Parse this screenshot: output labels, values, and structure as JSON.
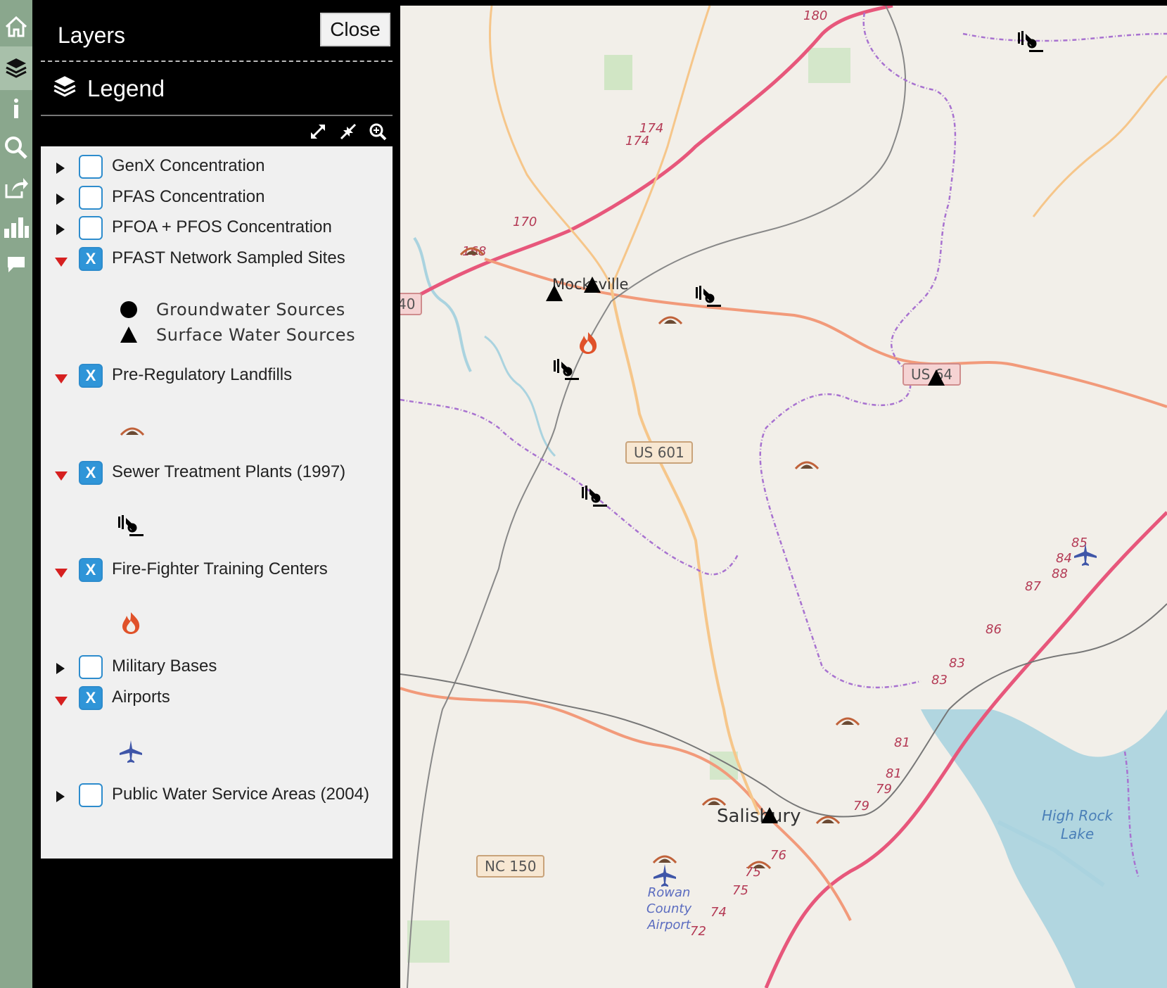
{
  "toolbar": {
    "icons": [
      "home-icon",
      "layers-icon",
      "info-icon",
      "search-icon",
      "share-icon",
      "chart-icon",
      "comment-icon"
    ]
  },
  "panel": {
    "title": "Layers",
    "close_label": "Close",
    "legend_title": "Legend",
    "controls": [
      "expand-icon",
      "collapse-icon",
      "zoom-icon"
    ]
  },
  "layers": [
    {
      "label": "GenX Concentration",
      "checked": false,
      "expanded": false
    },
    {
      "label": "PFAS Concentration",
      "checked": false,
      "expanded": false
    },
    {
      "label": "PFOA + PFOS Concentration",
      "checked": false,
      "expanded": false
    },
    {
      "label": "PFAST Network Sampled Sites",
      "checked": true,
      "expanded": true,
      "symbols": [
        {
          "shape": "circle",
          "label": "Groundwater Sources"
        },
        {
          "shape": "triangle",
          "label": "Surface Water Sources"
        }
      ]
    },
    {
      "label": "Pre-Regulatory Landfills",
      "checked": true,
      "expanded": true,
      "symbol": "landfill-icon"
    },
    {
      "label": "Sewer Treatment Plants (1997)",
      "checked": true,
      "expanded": true,
      "symbol": "sewer-plant-icon"
    },
    {
      "label": "Fire-Fighter Training Centers",
      "checked": true,
      "expanded": true,
      "symbol": "fire-icon"
    },
    {
      "label": "Military Bases",
      "checked": false,
      "expanded": false
    },
    {
      "label": "Airports",
      "checked": true,
      "expanded": true,
      "symbol": "airplane-icon"
    },
    {
      "label": "Public Water Service Areas (2004)",
      "checked": false,
      "expanded": false
    }
  ],
  "checkbox_mark": "X",
  "map": {
    "places": {
      "mocksville": "Mocksville",
      "salisbury": "Salisbury",
      "airport": [
        "Rowan",
        "County",
        "Airport"
      ],
      "lake": [
        "High Rock",
        "Lake"
      ]
    },
    "shields": {
      "us601": "US 601",
      "us64": "US 64",
      "nc150": "NC 150",
      "i40": "40"
    },
    "exits": [
      "180",
      "174",
      "174",
      "170",
      "168",
      "85",
      "84",
      "88",
      "87",
      "86",
      "83",
      "83",
      "81",
      "81",
      "79",
      "79",
      "76",
      "75",
      "75",
      "74",
      "72"
    ],
    "colors": {
      "motorway": "#e7577b",
      "trunk": "#f29a7a",
      "secondary": "#f6c68a",
      "rail": "#777777",
      "boundary": "#a872d0",
      "water": "#aad3df",
      "park": "#c8e4bc"
    }
  }
}
